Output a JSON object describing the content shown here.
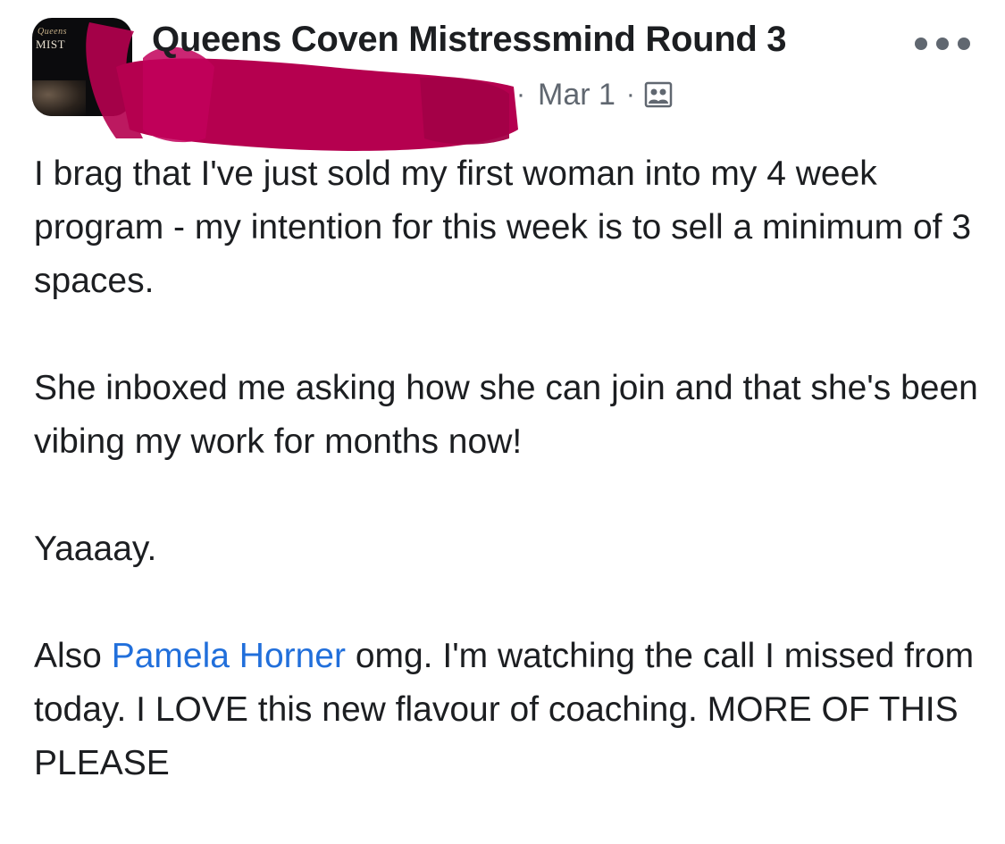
{
  "post": {
    "group_name": "Queens Coven Mistressmind Round 3",
    "avatar_cover_text_top": "Queens",
    "avatar_cover_text_main": "MIST",
    "date": "Mar 1",
    "separator": "·",
    "audience_icon": "group-members-icon",
    "more_icon": "more-options-icon",
    "redaction_color": "#b5004f",
    "paragraphs": [
      {
        "text": "I brag that I've just sold my first woman into my 4 week program - my intention for this week is to sell a minimum of 3 spaces."
      },
      {
        "text": "She inboxed me asking how she can join and that she's been vibing my work for months now!"
      },
      {
        "text": "Yaaaay."
      },
      {
        "before": "Also ",
        "mention": "Pamela Horner",
        "after": " omg. I'm watching the call I missed from today. I LOVE this new flavour of coaching. MORE OF THIS PLEASE"
      }
    ],
    "colors": {
      "text": "#1c1e21",
      "meta": "#606770",
      "mention": "#216fdb"
    }
  }
}
